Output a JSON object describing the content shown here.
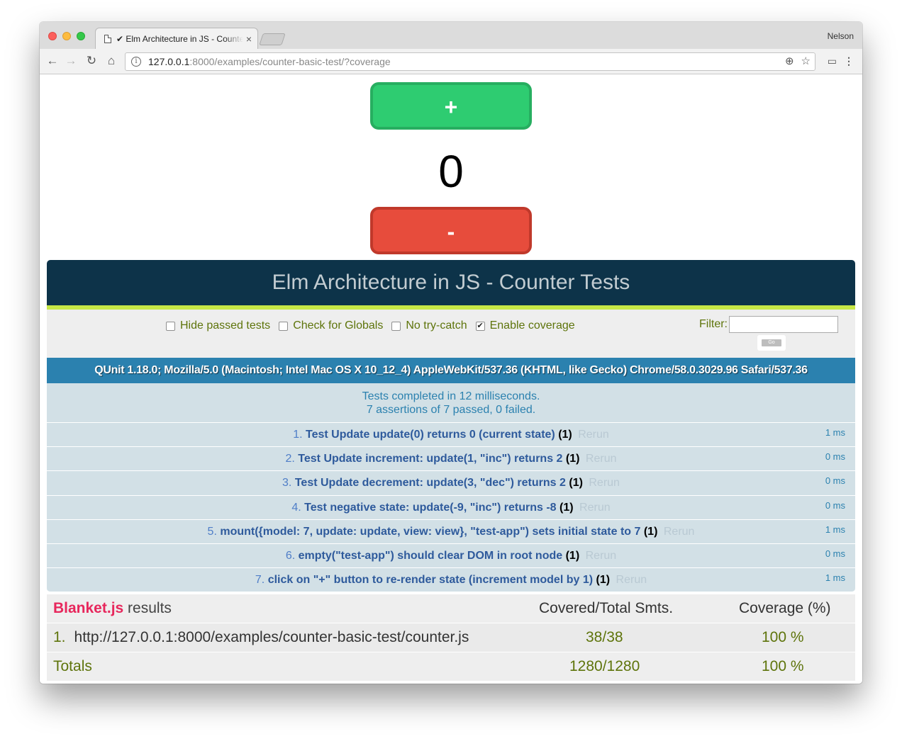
{
  "browser": {
    "tab_title": "✔ Elm Architecture in JS - Counter Tests",
    "tab_close": "×",
    "profile": "Nelson",
    "url_host": "127.0.0.1",
    "url_rest": ":8000/examples/counter-basic-test/?coverage",
    "info_glyph": "i"
  },
  "counter": {
    "increment_label": "+",
    "value": "0",
    "decrement_label": "-"
  },
  "qunit": {
    "title_prefix": "Elm Architecture in JS",
    "title_suffix": " - Counter Tests",
    "options": [
      {
        "label": "Hide passed tests",
        "checked": false
      },
      {
        "label": "Check for Globals",
        "checked": false
      },
      {
        "label": "No try-catch",
        "checked": false
      },
      {
        "label": "Enable coverage",
        "checked": true
      }
    ],
    "filter_label": "Filter:",
    "go_label": "Go",
    "user_agent": "QUnit 1.18.0; Mozilla/5.0 (Macintosh; Intel Mac OS X 10_12_4) AppleWebKit/537.36 (KHTML, like Gecko) Chrome/58.0.3029.96 Safari/537.36",
    "summary_line1": "Tests completed in 12 milliseconds.",
    "summary_line2": "7 assertions of 7 passed, 0 failed.",
    "tests": [
      {
        "num": "1.",
        "name": "Test Update update(0) returns 0 (current state)",
        "count": "(1)",
        "rerun": "Rerun",
        "time": "1 ms"
      },
      {
        "num": "2.",
        "name": "Test Update increment: update(1, \"inc\") returns 2",
        "count": "(1)",
        "rerun": "Rerun",
        "time": "0 ms"
      },
      {
        "num": "3.",
        "name": "Test Update decrement: update(3, \"dec\") returns 2",
        "count": "(1)",
        "rerun": "Rerun",
        "time": "0 ms"
      },
      {
        "num": "4.",
        "name": "Test negative state: update(-9, \"inc\") returns -8",
        "count": "(1)",
        "rerun": "Rerun",
        "time": "0 ms"
      },
      {
        "num": "5.",
        "name": "mount({model: 7, update: update, view: view}, \"test-app\") sets initial state to 7",
        "count": "(1)",
        "rerun": "Rerun",
        "time": "1 ms"
      },
      {
        "num": "6.",
        "name": "empty(\"test-app\") should clear DOM in root node",
        "count": "(1)",
        "rerun": "Rerun",
        "time": "0 ms"
      },
      {
        "num": "7.",
        "name": "click on \"+\" button to re-render state (increment model by 1)",
        "count": "(1)",
        "rerun": "Rerun",
        "time": "1 ms"
      }
    ]
  },
  "blanket": {
    "brand": "Blanket.js",
    "results_label": " results",
    "col_covered": "Covered/Total Smts.",
    "col_coverage": "Coverage (%)",
    "files": [
      {
        "num": "1.",
        "name": "http://127.0.0.1:8000/examples/counter-basic-test/counter.js",
        "covered": "38/38",
        "pct": "100 %"
      }
    ],
    "totals_label": "Totals",
    "totals_covered": "1280/1280",
    "totals_pct": "100 %"
  }
}
